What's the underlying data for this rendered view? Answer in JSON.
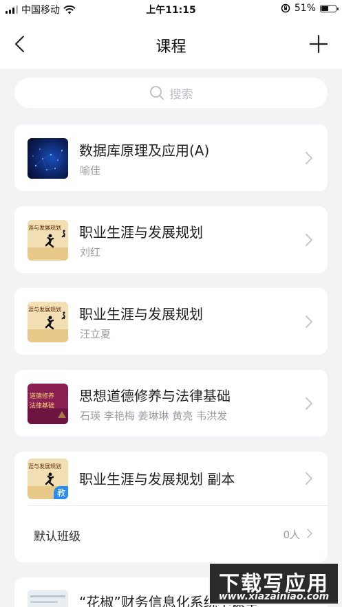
{
  "status_bar": {
    "carrier": "中国移动",
    "time": "上午11:15",
    "battery": "51%",
    "battery_level": 0.51,
    "icons": [
      "signal-icon",
      "wifi-icon",
      "rotation-lock-icon",
      "battery-icon"
    ]
  },
  "nav": {
    "title": "课程",
    "back_icon": "chevron-left-icon",
    "add_icon": "plus-icon"
  },
  "search": {
    "placeholder": "搜索",
    "icon": "search-icon"
  },
  "courses": [
    {
      "title": "数据库原理及应用(A)",
      "teacher": "喻佳",
      "thumbnail": "database-cover"
    },
    {
      "title": "职业生涯与发展规划",
      "teacher": "刘红",
      "thumbnail": "career-cover",
      "cover_text": "涯与发展规划"
    },
    {
      "title": "职业生涯与发展规划",
      "teacher": "汪立夏",
      "thumbnail": "career-cover",
      "cover_text": "涯与发展规划"
    },
    {
      "title": "思想道德修养与法律基础",
      "teacher": "石瑛 李艳梅 姜琳琳 黄亮 韦洪发",
      "thumbnail": "morality-cover",
      "cover_text_1": "道德修养",
      "cover_text_2": "法律基础"
    },
    {
      "title": "职业生涯与发展规划 副本",
      "teacher": "",
      "thumbnail": "career-cover",
      "cover_text": "涯与发展规划",
      "badge": "教",
      "class": {
        "name": "默认班级",
        "count": "0人"
      }
    },
    {
      "title": "“花椒”财务信息化系统小课堂",
      "teacher": "",
      "thumbnail": "finance-cover"
    }
  ],
  "watermark": {
    "main": "下载写应用",
    "sub": "www.xiazainiao.com"
  },
  "colors": {
    "background": "#f2f3f5",
    "card": "#ffffff",
    "badge": "#2b8cf0",
    "secondary_text": "#9a9da3"
  }
}
